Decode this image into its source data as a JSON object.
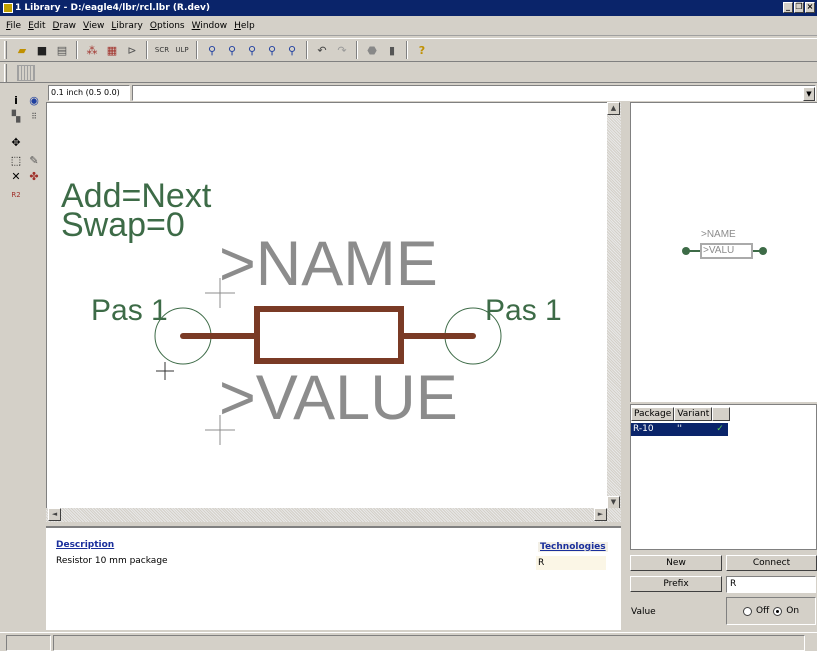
{
  "window": {
    "title": "1 Library - D:/eagle4/lbr/rcl.lbr (R.dev)"
  },
  "menu": [
    "File",
    "Edit",
    "Draw",
    "View",
    "Library",
    "Options",
    "Window",
    "Help"
  ],
  "toolbar_icons": [
    "open-icon",
    "save-icon",
    "print-icon",
    "schematic-icon",
    "board-icon",
    "symbol-icon",
    "script-icon",
    "ulp-icon",
    "zoom-fit-icon",
    "zoom-in-icon",
    "zoom-out-icon",
    "zoom-redraw-icon",
    "zoom-select-icon",
    "undo-icon",
    "redo-icon",
    "stop-icon",
    "go-icon",
    "help-icon"
  ],
  "coord_display": "0.1 inch (0.5 0.0)",
  "canvas": {
    "add": "Add=Next",
    "swap": "Swap=0",
    "name": ">NAME",
    "value": ">VALUE",
    "pin_left": "Pas 1",
    "pin_right": "Pas 1",
    "text_color": "#3d6b47",
    "placeholder_color": "#8c8c8c",
    "body_color": "#7a3a25"
  },
  "preview": {
    "name": ">NAME",
    "value": ">VALU"
  },
  "description": {
    "title": "Description",
    "text": "Resistor 10 mm package"
  },
  "technologies": {
    "title": "Technologies",
    "value": "R"
  },
  "packages": {
    "headers": [
      "Package",
      "Variant"
    ],
    "rows": [
      {
        "package": "R-10",
        "variant": "''",
        "check": "✓"
      }
    ]
  },
  "buttons": {
    "new": "New",
    "connect": "Connect",
    "prefix": "Prefix"
  },
  "prefix_value": "R",
  "value_label": "Value",
  "value_off": "Off",
  "value_on": "On"
}
